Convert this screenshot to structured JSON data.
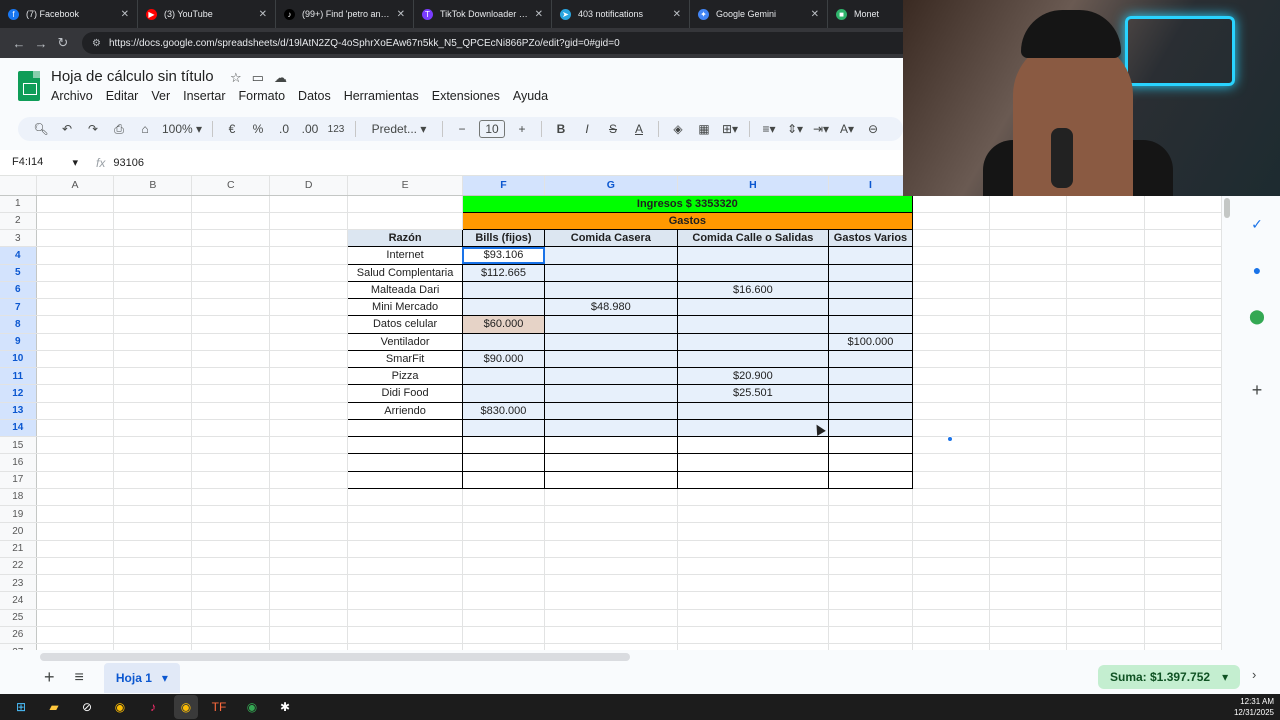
{
  "browser": {
    "tabs": [
      {
        "title": "(7) Facebook",
        "color": "#1877f2",
        "glyph": "f"
      },
      {
        "title": "(3) YouTube",
        "color": "#ff0000",
        "glyph": "▶"
      },
      {
        "title": "(99+) Find 'petro anuncia",
        "color": "#000000",
        "glyph": "♪"
      },
      {
        "title": "TikTok Downloader - Dow",
        "color": "#7a3cff",
        "glyph": "T"
      },
      {
        "title": "403 notifications",
        "color": "#2aa5e0",
        "glyph": "➤"
      },
      {
        "title": "Google Gemini",
        "color": "#4285f4",
        "glyph": "✦"
      },
      {
        "title": "Monet",
        "color": "#2fb36b",
        "glyph": "■"
      }
    ],
    "url": "https://docs.google.com/spreadsheets/d/19lAtN2ZQ-4oSphrXoEAw67n5kk_N5_QPCEcNi866PZo/edit?gid=0#gid=0"
  },
  "doc": {
    "title": "Hoja de cálculo sin título",
    "menu": [
      "Archivo",
      "Editar",
      "Ver",
      "Insertar",
      "Formato",
      "Datos",
      "Herramientas",
      "Extensiones",
      "Ayuda"
    ]
  },
  "toolbar": {
    "zoom": "100%",
    "currency": "€",
    "percent": "%",
    "dec_less": ".0",
    "dec_more": ".00",
    "number_format": "123",
    "font": "Predet...",
    "font_size": "10"
  },
  "formula_bar": {
    "name_box": "F4:I14",
    "value": "93106"
  },
  "grid": {
    "columns": [
      "A",
      "B",
      "C",
      "D",
      "E",
      "F",
      "G",
      "H",
      "I"
    ],
    "rows": [
      [
        "",
        "",
        "",
        "",
        "",
        "Ingresos $ 3353320",
        "",
        "",
        ""
      ],
      [
        "",
        "",
        "",
        "",
        "",
        "Gastos",
        "",
        "",
        ""
      ],
      [
        "",
        "",
        "",
        "",
        "Razón",
        "Bills (fijos)",
        "Comida Casera",
        "Comida Calle o Salidas",
        "Gastos Varios"
      ],
      [
        "",
        "",
        "",
        "",
        "Internet",
        "$93.106",
        "",
        "",
        ""
      ],
      [
        "",
        "",
        "",
        "",
        "Salud Complentaria",
        "$112.665",
        "",
        "",
        ""
      ],
      [
        "",
        "",
        "",
        "",
        "Malteada Dari",
        "",
        "",
        "$16.600",
        ""
      ],
      [
        "",
        "",
        "",
        "",
        "Mini Mercado",
        "",
        "$48.980",
        "",
        ""
      ],
      [
        "",
        "",
        "",
        "",
        "Datos celular",
        "$60.000",
        "",
        "",
        ""
      ],
      [
        "",
        "",
        "",
        "",
        "Ventilador",
        "",
        "",
        "",
        "$100.000"
      ],
      [
        "",
        "",
        "",
        "",
        "SmarFit",
        "$90.000",
        "",
        "",
        ""
      ],
      [
        "",
        "",
        "",
        "",
        "Pizza",
        "",
        "",
        "$20.900",
        ""
      ],
      [
        "",
        "",
        "",
        "",
        "Didi Food",
        "",
        "",
        "$25.501",
        ""
      ],
      [
        "",
        "",
        "",
        "",
        "Arriendo",
        "$830.000",
        "",
        "",
        ""
      ],
      [
        "",
        "",
        "",
        "",
        "",
        "",
        "",
        "",
        ""
      ],
      [
        "",
        "",
        "",
        "",
        "",
        "",
        "",
        "",
        ""
      ],
      [
        "",
        "",
        "",
        "",
        "",
        "",
        "",
        "",
        ""
      ],
      [
        "",
        "",
        "",
        "",
        "",
        "",
        "",
        "",
        ""
      ],
      [
        "",
        "",
        "",
        "",
        "",
        "",
        "",
        "",
        ""
      ],
      [
        "",
        "",
        "",
        "",
        "",
        "",
        "",
        "",
        ""
      ],
      [
        "",
        "",
        "",
        "",
        "",
        "",
        "",
        "",
        ""
      ],
      [
        "",
        "",
        "",
        "",
        "",
        "",
        "",
        "",
        ""
      ],
      [
        "",
        "",
        "",
        "",
        "",
        "",
        "",
        "",
        ""
      ],
      [
        "",
        "",
        "",
        "",
        "",
        "",
        "",
        "",
        ""
      ],
      [
        "",
        "",
        "",
        "",
        "",
        "",
        "",
        "",
        ""
      ],
      [
        "",
        "",
        "",
        "",
        "",
        "",
        "",
        "",
        ""
      ],
      [
        "",
        "",
        "",
        "",
        "",
        "",
        "",
        "",
        ""
      ],
      [
        "",
        "",
        "",
        "",
        "",
        "",
        "",
        "",
        ""
      ]
    ],
    "colors": {
      "income": "#00ff00",
      "expenses": "#ff9900",
      "header": "#dce6f1",
      "selection": "#1a73e8"
    }
  },
  "sheet_bar": {
    "tab_label": "Hoja 1",
    "sum_label": "Suma: $1.397.752"
  },
  "taskbar": {
    "time": "12:31 AM",
    "date": "12/31/2025"
  }
}
